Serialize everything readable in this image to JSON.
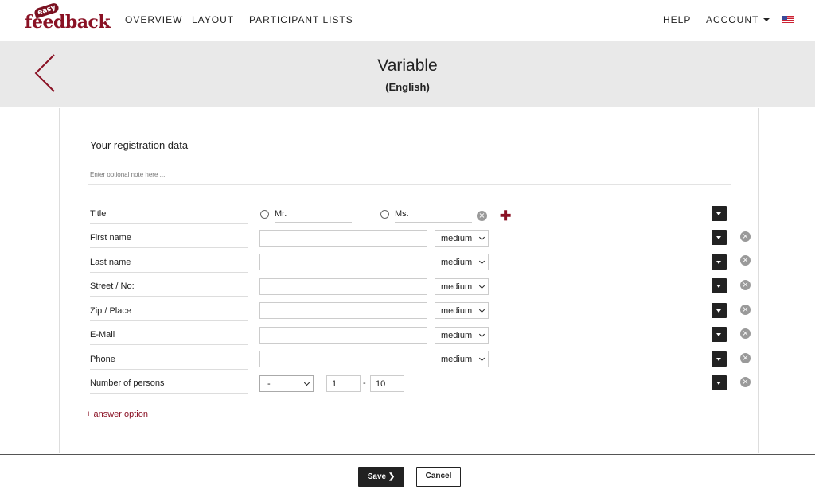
{
  "logo": {
    "small": "easy",
    "main": "feedback"
  },
  "nav": {
    "overview": "OVERVIEW",
    "layout": "LAYOUT",
    "participant_lists": "PARTICIPANT LISTS",
    "help": "HELP",
    "account": "ACCOUNT"
  },
  "header": {
    "title": "Variable",
    "subtitle": "(English)"
  },
  "section": {
    "title": "Your registration data",
    "note_placeholder": "Enter optional note here ..."
  },
  "title_row": {
    "label": "Title",
    "option1": "Mr.",
    "option2": "Ms."
  },
  "fields": [
    {
      "label": "First name",
      "size": "medium"
    },
    {
      "label": "Last name",
      "size": "medium"
    },
    {
      "label": "Street / No:",
      "size": "medium"
    },
    {
      "label": "Zip / Place",
      "size": "medium"
    },
    {
      "label": "E-Mail",
      "size": "medium"
    },
    {
      "label": "Phone",
      "size": "medium"
    }
  ],
  "persons": {
    "label": "Number of persons",
    "select": "-",
    "min": "1",
    "max": "10"
  },
  "answer_option": "+ answer option",
  "buttons": {
    "save": "Save",
    "cancel": "Cancel"
  },
  "colors": {
    "brand": "#8a1124",
    "header_bg": "#e9e9e9",
    "dark": "#222222"
  }
}
